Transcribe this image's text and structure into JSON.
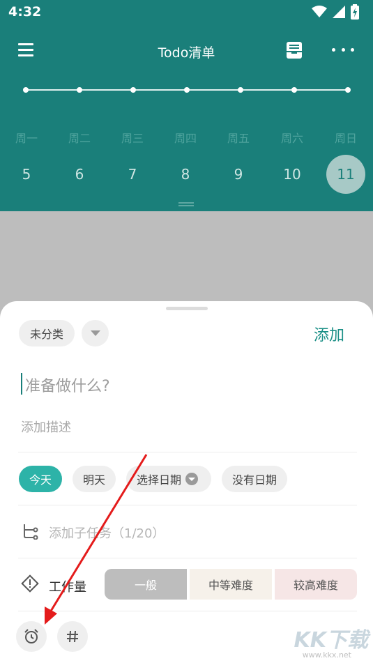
{
  "status_bar": {
    "time": "4:32"
  },
  "toolbar": {
    "title": "Todo清单"
  },
  "week": {
    "days": [
      "周一",
      "周二",
      "周三",
      "周四",
      "周五",
      "周六",
      "周日"
    ],
    "dates": [
      "5",
      "6",
      "7",
      "8",
      "9",
      "10",
      "11"
    ],
    "selected_date": "11"
  },
  "sheet": {
    "category_label": "未分类",
    "add_label": "添加",
    "task_placeholder": "准备做什么?",
    "description_placeholder": "添加描述",
    "date_options": {
      "today": "今天",
      "tomorrow": "明天",
      "pick_date": "选择日期",
      "no_date": "没有日期"
    },
    "subtask_label": "添加子任务（1/20）",
    "workload": {
      "label": "工作量",
      "options": [
        "一般",
        "中等难度",
        "较高难度"
      ],
      "selected": "一般"
    }
  },
  "watermark": {
    "brand": "KK下载",
    "url": "www.kkx.net"
  },
  "colors": {
    "primary": "#1a7f7a",
    "accent": "#2db3a8",
    "annotation_arrow": "#e41b1b"
  }
}
